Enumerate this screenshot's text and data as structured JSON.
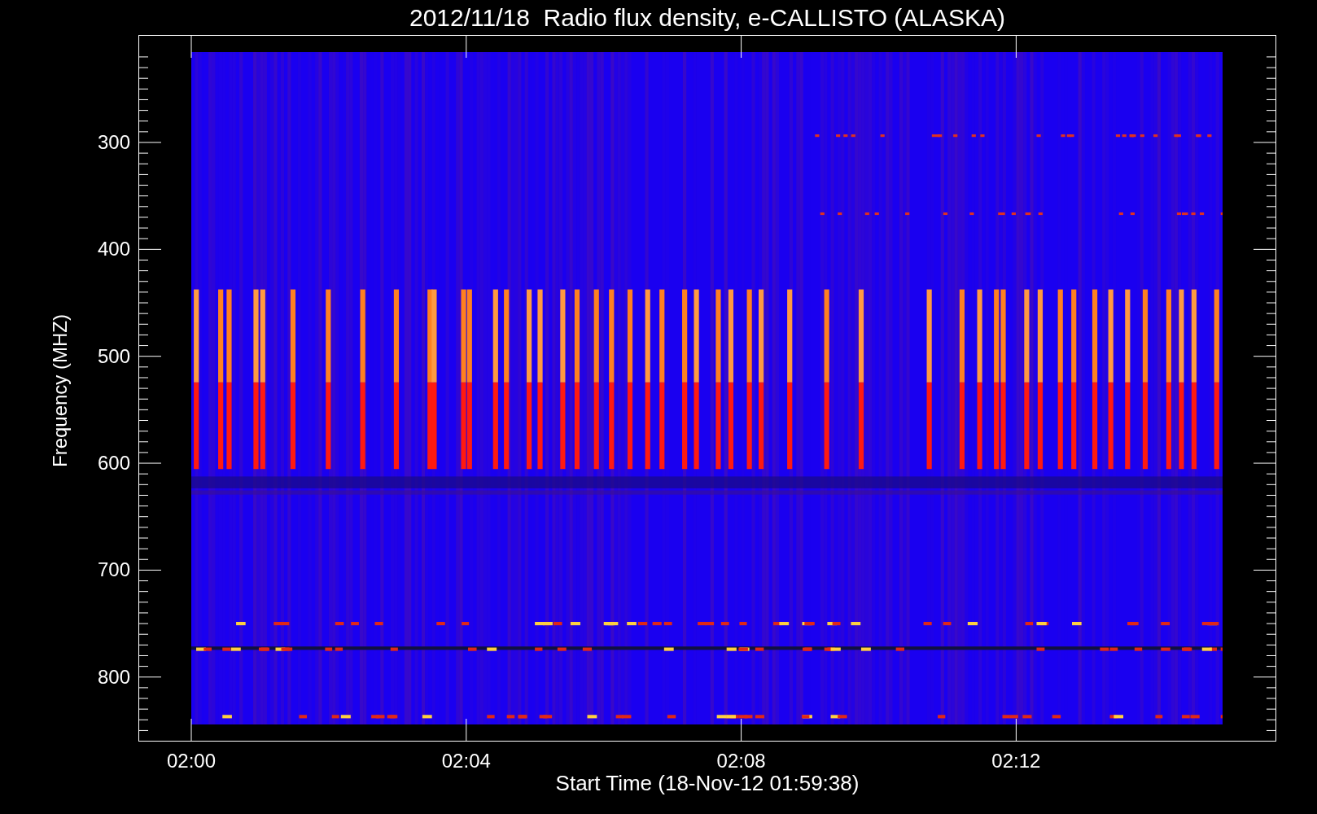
{
  "title": "2012/11/18  Radio flux density, e-CALLISTO (ALASKA)",
  "y_axis": {
    "label": "Frequency (MHZ)",
    "ticks": [
      "300",
      "400",
      "500",
      "600",
      "700",
      "800"
    ]
  },
  "x_axis": {
    "label": "Start Time (18-Nov-12 01:59:38)",
    "ticks": [
      "02:00",
      "02:04",
      "02:08",
      "02:12"
    ]
  }
}
